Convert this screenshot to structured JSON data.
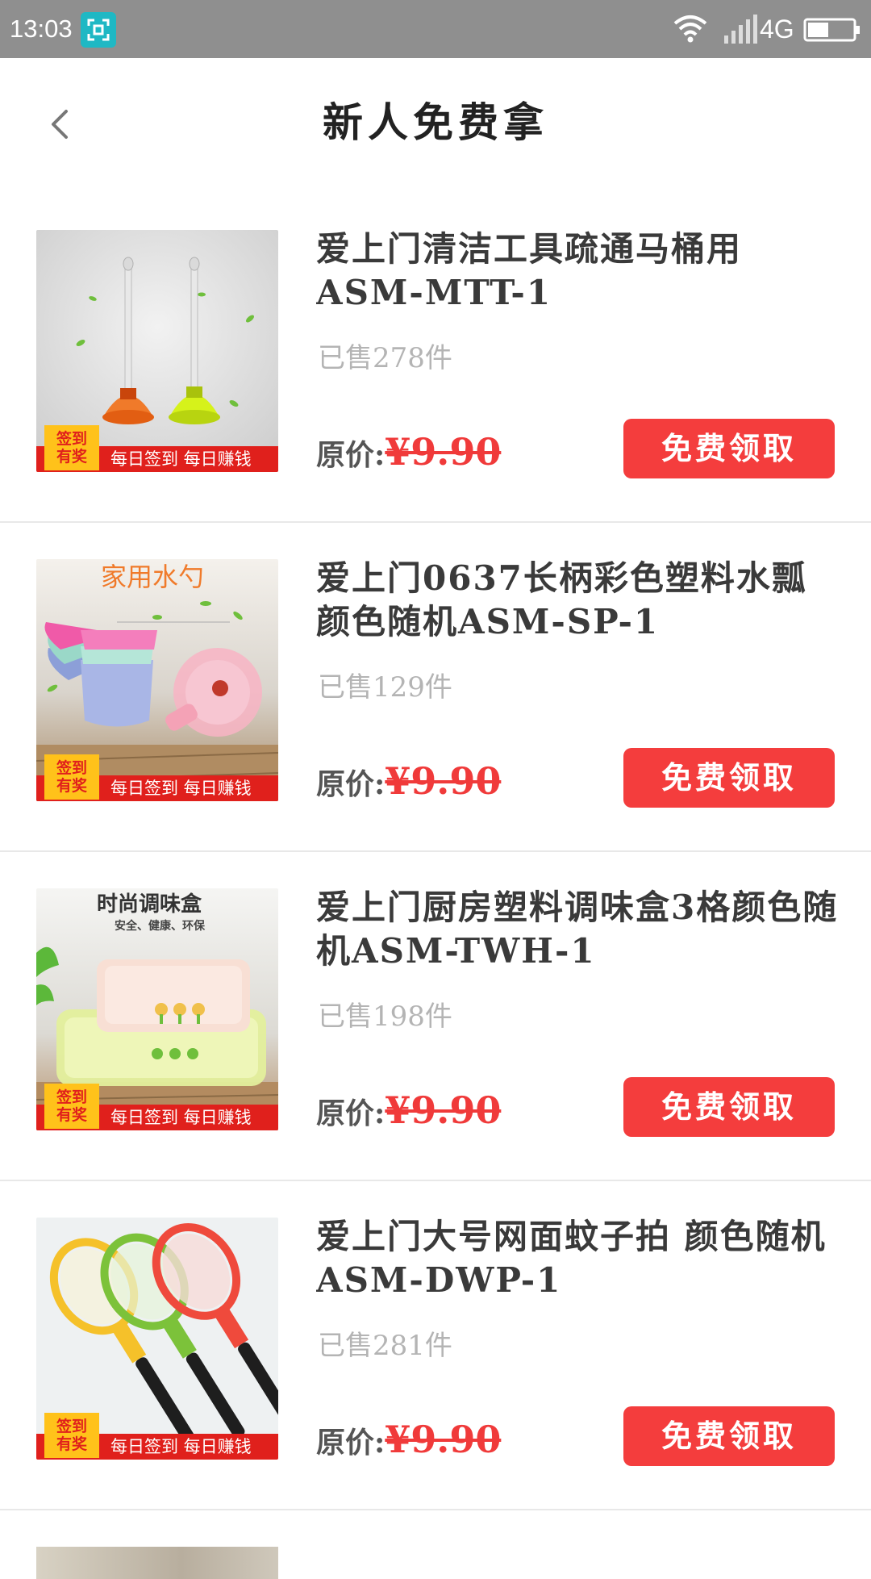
{
  "status_bar": {
    "time": "13:03",
    "network": "4G",
    "icons": [
      "screenshot-icon",
      "wifi-icon",
      "signal-icon",
      "battery-icon"
    ]
  },
  "nav": {
    "title": "新人免费拿",
    "back_icon": "chevron-left-icon"
  },
  "colors": {
    "accent": "#f43d3d",
    "status_bar": "#8f8f8f",
    "ribbon": "#e0201c",
    "badge": "#ffc21a"
  },
  "thumb_common": {
    "badge_line1": "签到",
    "badge_line2": "有奖",
    "slogan": "每日签到  每日赚钱"
  },
  "products": [
    {
      "name": "爱上门清洁工具疏通马桶用ASM-MTT-1",
      "sold": "已售278件",
      "price_label": "原价:",
      "price": "¥9.90",
      "button": "免费领取",
      "image": "toilet-plunger-image",
      "caption": "",
      "subcaption": ""
    },
    {
      "name": "爱上门0637长柄彩色塑料水瓢颜色随机ASM-SP-1",
      "sold": "已售129件",
      "price_label": "原价:",
      "price": "¥9.90",
      "button": "免费领取",
      "image": "water-ladle-image",
      "caption": "家用水勺",
      "subcaption": ""
    },
    {
      "name": "爱上门厨房塑料调味盒3格颜色随机ASM-TWH-1",
      "sold": "已售198件",
      "price_label": "原价:",
      "price": "¥9.90",
      "button": "免费领取",
      "image": "seasoning-box-image",
      "caption": "时尚调味盒",
      "subcaption": "安全、健康、环保"
    },
    {
      "name": "爱上门大号网面蚊子拍 颜色随机ASM-DWP-1",
      "sold": "已售281件",
      "price_label": "原价:",
      "price": "¥9.90",
      "button": "免费领取",
      "image": "mosquito-swatter-image",
      "caption": "",
      "subcaption": ""
    }
  ]
}
